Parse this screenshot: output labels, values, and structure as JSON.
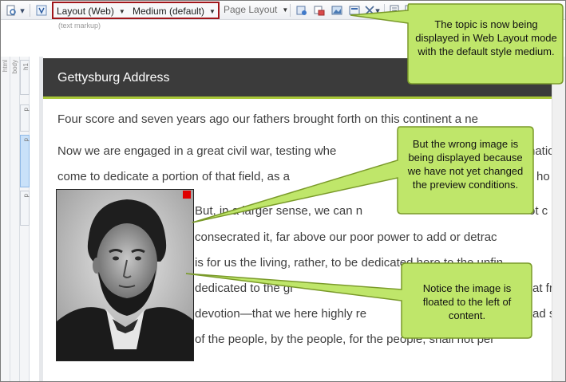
{
  "toolbar": {
    "layout_value": "Layout (Web)",
    "medium_value": "Medium (default)",
    "page_layout_label": "Page Layout",
    "hint_text": "(text markup)"
  },
  "side_tags": {
    "html": "html",
    "body": "body",
    "h1": "h1",
    "p": "p"
  },
  "topic": {
    "title": "Gettysburg Address",
    "lines": [
      "Four score and seven years ago our fathers brought forth on this continent a ne",
      "Now we are engaged in a great civil war, testing whe",
      "come to dedicate a portion of that field, as a",
      "But, in a larger sense, we can n",
      "consecrated it, far above our poor power to add or detrac",
      "is for us the living, rather, to be dedicated here to the unfin",
      "dedicated to the gr",
      "devotion—that we here highly re",
      "of the people, by the people, for the people, shall not per"
    ],
    "fragments": [
      "naticu",
      "ho h",
      "ot c",
      "at fro",
      "ad sh"
    ]
  },
  "callouts": {
    "top": "The topic is now being displayed in Web Layout mode with the default style medium.",
    "middle": "But the wrong image is being displayed because we have not yet changed the preview conditions.",
    "bottom": "Notice the image is floated to the left of content."
  },
  "colors": {
    "callout_fill": "#bfe66a",
    "callout_border": "#7a9a2a",
    "header_bg": "#3b3b3b",
    "accent": "#a9c738",
    "highlight_box": "#a0161b"
  }
}
